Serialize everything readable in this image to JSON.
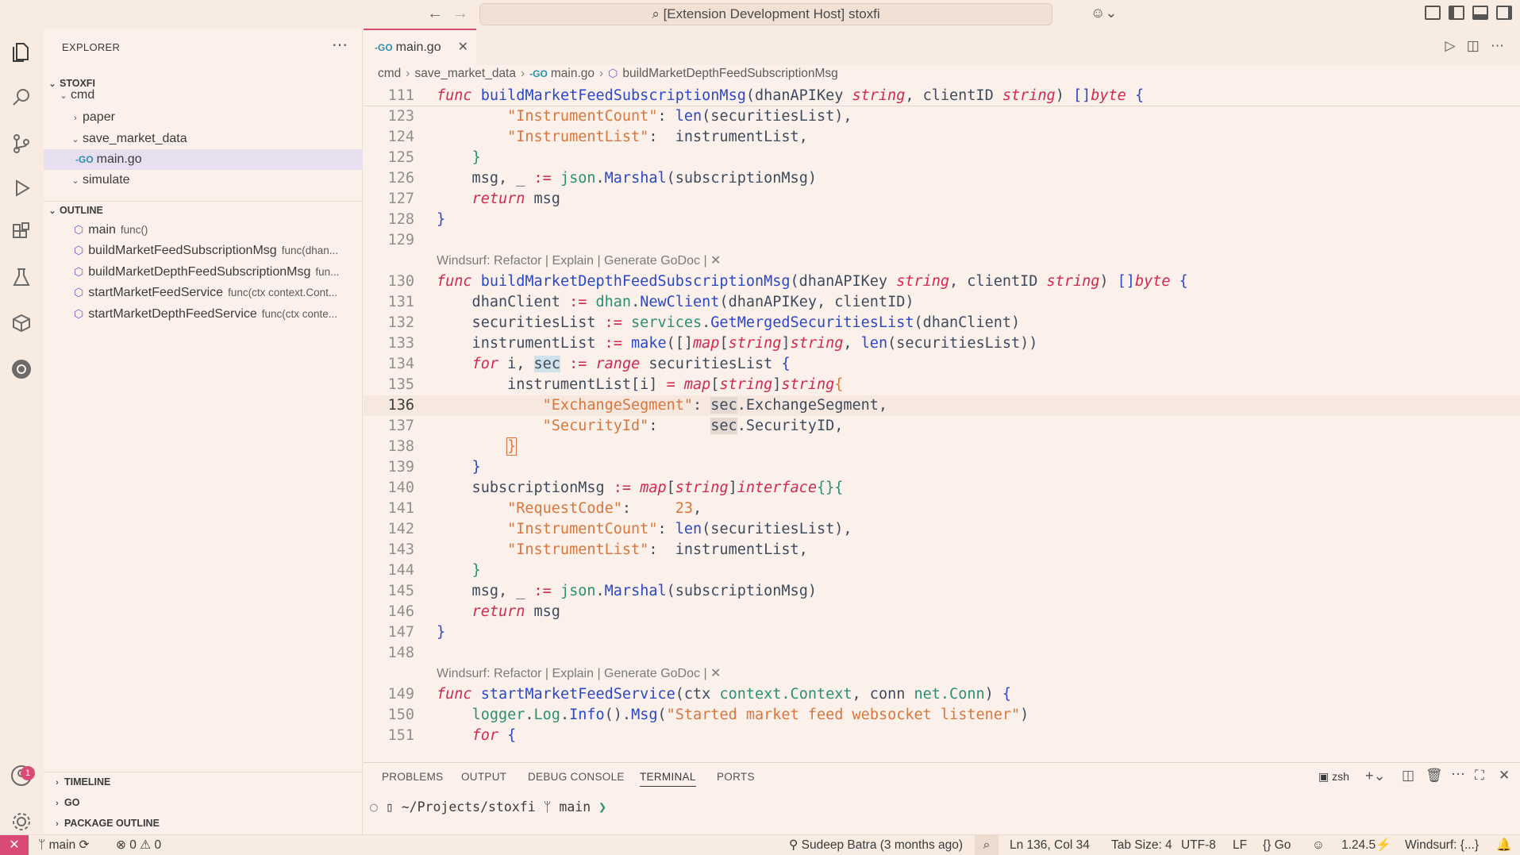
{
  "titlebar": {
    "command_center": "[Extension Development Host] stoxfi"
  },
  "sidebar": {
    "title": "EXPLORER",
    "workspace": "STOXFI",
    "tree": [
      {
        "label": "cmd"
      },
      {
        "label": "paper"
      },
      {
        "label": "save_market_data"
      },
      {
        "label": "main.go"
      },
      {
        "label": "simulate"
      }
    ],
    "outline_title": "OUTLINE",
    "outline": [
      {
        "name": "main",
        "detail": "func()"
      },
      {
        "name": "buildMarketFeedSubscriptionMsg",
        "detail": "func(dhan..."
      },
      {
        "name": "buildMarketDepthFeedSubscriptionMsg",
        "detail": "fun..."
      },
      {
        "name": "startMarketFeedService",
        "detail": "func(ctx context.Cont..."
      },
      {
        "name": "startMarketDepthFeedService",
        "detail": "func(ctx conte..."
      }
    ],
    "bottom_sections": [
      "TIMELINE",
      "GO",
      "PACKAGE OUTLINE"
    ]
  },
  "tab": {
    "badge": "-GO",
    "label": "main.go"
  },
  "breadcrumb": [
    "cmd",
    "save_market_data",
    "main.go",
    "buildMarketDepthFeedSubscriptionMsg"
  ],
  "editor": {
    "lens_text": "Windsurf: Refactor | Explain | Generate GoDoc | ✕",
    "line_numbers": [
      "111",
      "123",
      "124",
      "125",
      "126",
      "127",
      "128",
      "129",
      "130",
      "131",
      "132",
      "133",
      "134",
      "135",
      "136",
      "137",
      "138",
      "139",
      "140",
      "141",
      "142",
      "143",
      "144",
      "145",
      "146",
      "147",
      "148",
      "149",
      "150",
      "151"
    ],
    "current_line": "136"
  },
  "panel": {
    "tabs": [
      "PROBLEMS",
      "OUTPUT",
      "DEBUG CONSOLE",
      "TERMINAL",
      "PORTS"
    ],
    "active_tab": "TERMINAL",
    "shell": "zsh",
    "terminal_prompt": "~/Projects/stoxfi",
    "terminal_branch": "main"
  },
  "statusbar": {
    "branch": "main",
    "errors": "0",
    "warnings": "0",
    "blame": "Sudeep Batra (3 months ago)",
    "position": "Ln 136, Col 34",
    "tab_size": "Tab Size: 4",
    "encoding": "UTF-8",
    "eol": "LF",
    "language": "Go",
    "go_version": "1.24.5",
    "windsurf": "Windsurf: {...}"
  },
  "accounts_badge": "1"
}
